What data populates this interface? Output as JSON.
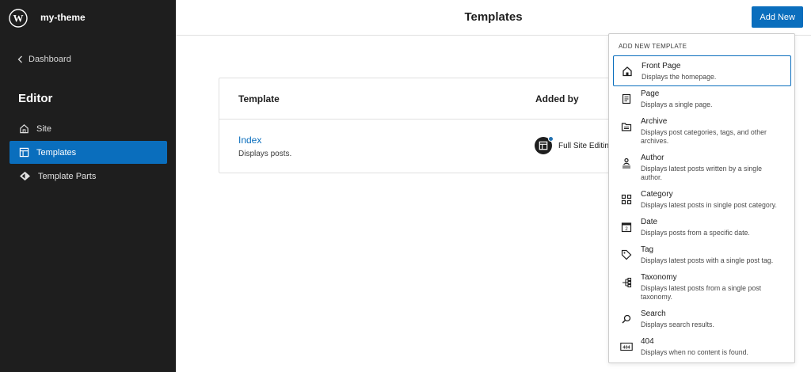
{
  "sidebar": {
    "site_name": "my-theme",
    "back_link": "Dashboard",
    "section_title": "Editor",
    "items": [
      {
        "label": "Site",
        "icon": "home-icon"
      },
      {
        "label": "Templates",
        "icon": "layout-icon",
        "active": true
      },
      {
        "label": "Template Parts",
        "icon": "symbol-icon"
      }
    ]
  },
  "header": {
    "title": "Templates",
    "add_new_label": "Add New"
  },
  "table": {
    "headers": [
      "Template",
      "Added by"
    ],
    "rows": [
      {
        "name": "Index",
        "description": "Displays posts.",
        "added_by": "Full Site Editin"
      }
    ]
  },
  "dropdown": {
    "title": "ADD NEW TEMPLATE",
    "items": [
      {
        "label": "Front Page",
        "description": "Displays the homepage."
      },
      {
        "label": "Page",
        "description": "Displays a single page."
      },
      {
        "label": "Archive",
        "description": "Displays post categories, tags, and other archives."
      },
      {
        "label": "Author",
        "description": "Displays latest posts written by a single author."
      },
      {
        "label": "Category",
        "description": "Displays latest posts in single post category."
      },
      {
        "label": "Date",
        "description": "Displays posts from a specific date."
      },
      {
        "label": "Tag",
        "description": "Displays latest posts with a single post tag."
      },
      {
        "label": "Taxonomy",
        "description": "Displays latest posts from a single post taxonomy."
      },
      {
        "label": "Search",
        "description": "Displays search results."
      },
      {
        "label": "404",
        "description": "Displays when no content is found."
      }
    ]
  },
  "colors": {
    "accent": "#0a6ebd",
    "sidebar_bg": "#1e1e1e"
  }
}
